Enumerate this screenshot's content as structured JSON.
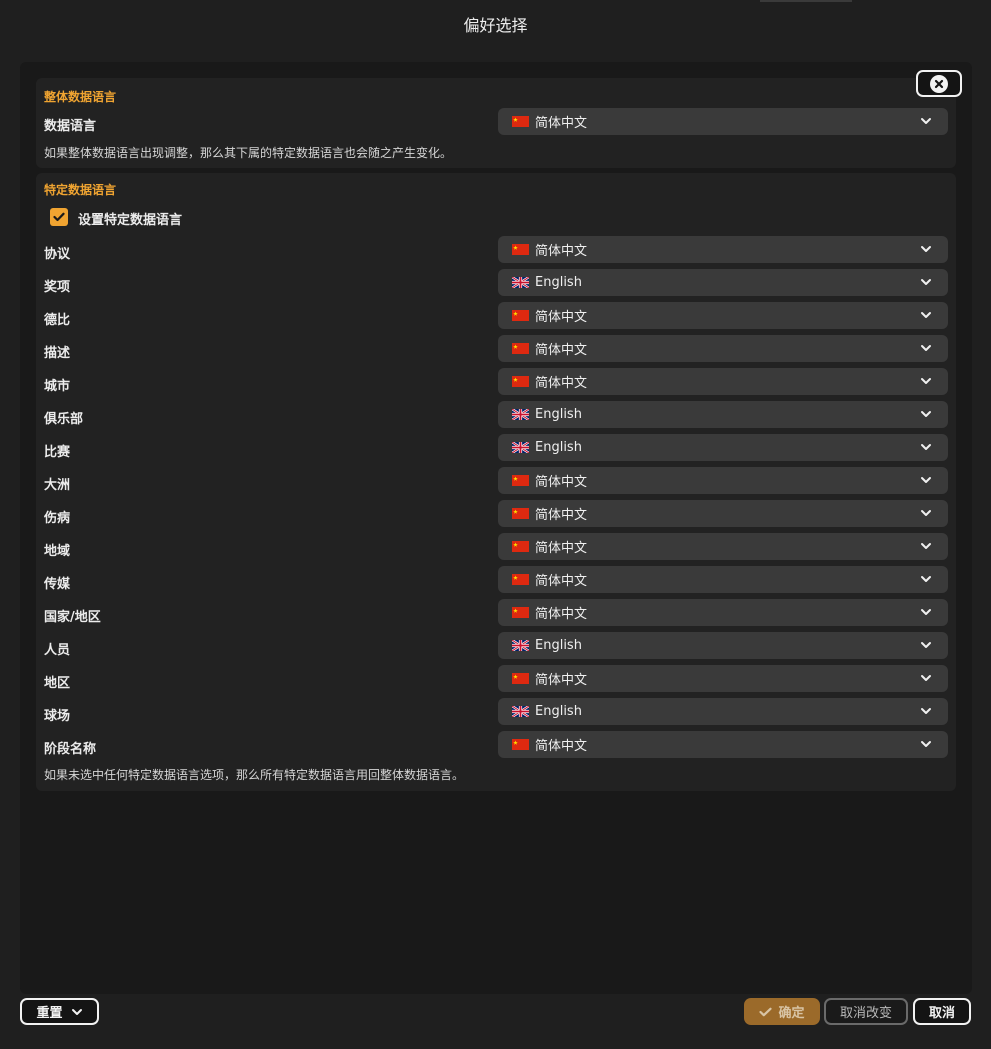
{
  "window": {
    "title": "偏好选择"
  },
  "overall": {
    "section_title": "整体数据语言",
    "label": "数据语言",
    "value": "简体中文",
    "flag": "cn",
    "note": "如果整体数据语言出现调整，那么其下属的特定数据语言也会随之产生变化。"
  },
  "specific": {
    "section_title": "特定数据语言",
    "checkbox_label": "设置特定数据语言",
    "checked": true,
    "rows": [
      {
        "label": "协议",
        "value": "简体中文",
        "flag": "cn"
      },
      {
        "label": "奖项",
        "value": "English",
        "flag": "uk"
      },
      {
        "label": "德比",
        "value": "简体中文",
        "flag": "cn"
      },
      {
        "label": "描述",
        "value": "简体中文",
        "flag": "cn"
      },
      {
        "label": "城市",
        "value": "简体中文",
        "flag": "cn"
      },
      {
        "label": "俱乐部",
        "value": "English",
        "flag": "uk"
      },
      {
        "label": "比赛",
        "value": "English",
        "flag": "uk"
      },
      {
        "label": "大洲",
        "value": "简体中文",
        "flag": "cn"
      },
      {
        "label": "伤病",
        "value": "简体中文",
        "flag": "cn"
      },
      {
        "label": "地域",
        "value": "简体中文",
        "flag": "cn"
      },
      {
        "label": "传媒",
        "value": "简体中文",
        "flag": "cn"
      },
      {
        "label": "国家/地区",
        "value": "简体中文",
        "flag": "cn"
      },
      {
        "label": "人员",
        "value": "English",
        "flag": "uk"
      },
      {
        "label": "地区",
        "value": "简体中文",
        "flag": "cn"
      },
      {
        "label": "球场",
        "value": "English",
        "flag": "uk"
      },
      {
        "label": "阶段名称",
        "value": "简体中文",
        "flag": "cn"
      }
    ],
    "note": "如果未选中任何特定数据语言选项，那么所有特定数据语言用回整体数据语言。"
  },
  "footer": {
    "reset_label": "重置",
    "ok_label": "确定",
    "revert_label": "取消改变",
    "cancel_label": "取消"
  },
  "icons": {
    "close": "close-icon",
    "chevron": "chevron-down-icon",
    "check": "checkmark-icon",
    "flag_cn": "china-flag-icon",
    "flag_uk": "uk-flag-icon"
  },
  "colors": {
    "accent": "#f0a431",
    "background": "#1f1f1f",
    "panel": "#191919",
    "section": "#222222",
    "select": "#3a3a3a"
  }
}
